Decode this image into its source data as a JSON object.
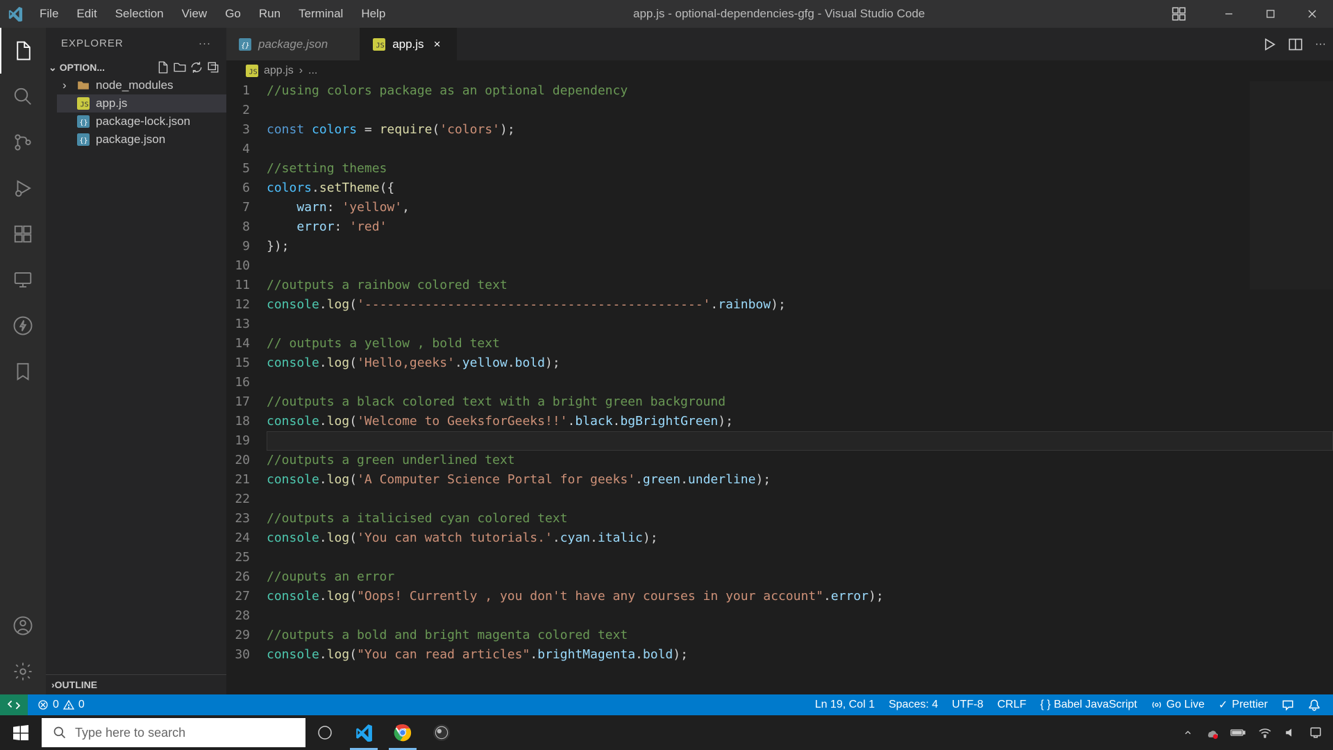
{
  "window": {
    "title": "app.js - optional-dependencies-gfg - Visual Studio Code"
  },
  "menus": [
    "File",
    "Edit",
    "Selection",
    "View",
    "Go",
    "Run",
    "Terminal",
    "Help"
  ],
  "explorer": {
    "title": "EXPLORER",
    "project": "OPTION...",
    "outline": "OUTLINE",
    "files": {
      "node_modules": "node_modules",
      "app": "app.js",
      "pkglock": "package-lock.json",
      "pkg": "package.json"
    }
  },
  "tabs": {
    "pkg": "package.json",
    "app": "app.js"
  },
  "breadcrumb": {
    "file": "app.js",
    "sep": "›",
    "rest": "..."
  },
  "code": {
    "lines": [
      {
        "n": 1,
        "t": "comment",
        "text": "//using colors package as an optional dependency"
      },
      {
        "n": 2,
        "t": "blank",
        "text": ""
      },
      {
        "n": 3,
        "t": "raw",
        "html": "<span class='c-keyword'>const</span> <span class='c-constant'>colors</span> <span class='c-plain'>=</span> <span class='c-func'>require</span><span class='c-plain'>(</span><span class='c-string'>'colors'</span><span class='c-plain'>);</span>"
      },
      {
        "n": 4,
        "t": "blank",
        "text": ""
      },
      {
        "n": 5,
        "t": "comment",
        "text": "//setting themes"
      },
      {
        "n": 6,
        "t": "raw",
        "html": "<span class='c-constant'>colors</span><span class='c-plain'>.</span><span class='c-func'>setTheme</span><span class='c-plain'>({</span>"
      },
      {
        "n": 7,
        "t": "raw",
        "html": "    <span class='c-variable'>warn</span><span class='c-plain'>:</span> <span class='c-string'>'yellow'</span><span class='c-plain'>,</span>"
      },
      {
        "n": 8,
        "t": "raw",
        "html": "    <span class='c-variable'>error</span><span class='c-plain'>:</span> <span class='c-string'>'red'</span>"
      },
      {
        "n": 9,
        "t": "raw",
        "html": "<span class='c-plain'>});</span>"
      },
      {
        "n": 10,
        "t": "blank",
        "text": ""
      },
      {
        "n": 11,
        "t": "comment",
        "text": "//outputs a rainbow colored text"
      },
      {
        "n": 12,
        "t": "raw",
        "html": "<span class='c-obj'>console</span><span class='c-plain'>.</span><span class='c-func'>log</span><span class='c-plain'>(</span><span class='c-string'>'---------------------------------------------'</span><span class='c-plain'>.</span><span class='c-variable'>rainbow</span><span class='c-plain'>);</span>"
      },
      {
        "n": 13,
        "t": "blank",
        "text": ""
      },
      {
        "n": 14,
        "t": "comment",
        "text": "// outputs a yellow , bold text"
      },
      {
        "n": 15,
        "t": "raw",
        "html": "<span class='c-obj'>console</span><span class='c-plain'>.</span><span class='c-func'>log</span><span class='c-plain'>(</span><span class='c-string'>'Hello,geeks'</span><span class='c-plain'>.</span><span class='c-variable'>yellow</span><span class='c-plain'>.</span><span class='c-variable'>bold</span><span class='c-plain'>);</span>"
      },
      {
        "n": 16,
        "t": "blank",
        "text": ""
      },
      {
        "n": 17,
        "t": "comment",
        "text": "//outputs a black colored text with a bright green background"
      },
      {
        "n": 18,
        "t": "raw",
        "html": "<span class='c-obj'>console</span><span class='c-plain'>.</span><span class='c-func'>log</span><span class='c-plain'>(</span><span class='c-string'>'Welcome to GeeksforGeeks!!'</span><span class='c-plain'>.</span><span class='c-variable'>black</span><span class='c-plain'>.</span><span class='c-variable'>bgBrightGreen</span><span class='c-plain'>);</span>"
      },
      {
        "n": 19,
        "t": "blank",
        "text": "",
        "cursor": true
      },
      {
        "n": 20,
        "t": "comment",
        "text": "//outputs a green underlined text"
      },
      {
        "n": 21,
        "t": "raw",
        "html": "<span class='c-obj'>console</span><span class='c-plain'>.</span><span class='c-func'>log</span><span class='c-plain'>(</span><span class='c-string'>'A Computer Science Portal for geeks'</span><span class='c-plain'>.</span><span class='c-variable'>green</span><span class='c-plain'>.</span><span class='c-variable'>underline</span><span class='c-plain'>);</span>"
      },
      {
        "n": 22,
        "t": "blank",
        "text": ""
      },
      {
        "n": 23,
        "t": "comment",
        "text": "//outputs a italicised cyan colored text"
      },
      {
        "n": 24,
        "t": "raw",
        "html": "<span class='c-obj'>console</span><span class='c-plain'>.</span><span class='c-func'>log</span><span class='c-plain'>(</span><span class='c-string'>'You can watch tutorials.'</span><span class='c-plain'>.</span><span class='c-variable'>cyan</span><span class='c-plain'>.</span><span class='c-variable'>italic</span><span class='c-plain'>);</span>"
      },
      {
        "n": 25,
        "t": "blank",
        "text": ""
      },
      {
        "n": 26,
        "t": "comment",
        "text": "//ouputs an error"
      },
      {
        "n": 27,
        "t": "raw",
        "html": "<span class='c-obj'>console</span><span class='c-plain'>.</span><span class='c-func'>log</span><span class='c-plain'>(</span><span class='c-string'>\"Oops! Currently , you don't have any courses in your account\"</span><span class='c-plain'>.</span><span class='c-variable'>error</span><span class='c-plain'>);</span>"
      },
      {
        "n": 28,
        "t": "blank",
        "text": ""
      },
      {
        "n": 29,
        "t": "comment",
        "text": "//outputs a bold and bright magenta colored text"
      },
      {
        "n": 30,
        "t": "raw",
        "html": "<span class='c-obj'>console</span><span class='c-plain'>.</span><span class='c-func'>log</span><span class='c-plain'>(</span><span class='c-string'>\"You can read articles\"</span><span class='c-plain'>.</span><span class='c-variable'>brightMagenta</span><span class='c-plain'>.</span><span class='c-variable'>bold</span><span class='c-plain'>);</span>"
      }
    ]
  },
  "status": {
    "errors": "0",
    "warnings": "0",
    "position": "Ln 19, Col 1",
    "spaces": "Spaces: 4",
    "encoding": "UTF-8",
    "eol": "CRLF",
    "lang": "{ } Babel JavaScript",
    "golive": "Go Live",
    "prettier": "Prettier"
  },
  "taskbar": {
    "search_placeholder": "Type here to search"
  }
}
